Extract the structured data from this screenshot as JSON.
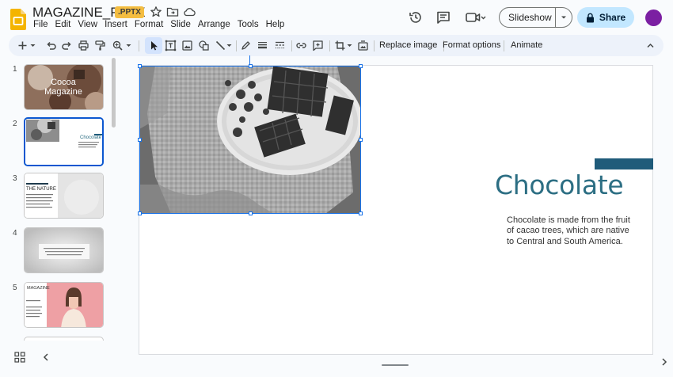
{
  "header": {
    "title": "MAGAZINE_PPTX",
    "badge": ".PPTX",
    "menu": [
      "File",
      "Edit",
      "View",
      "Insert",
      "Format",
      "Slide",
      "Arrange",
      "Tools",
      "Help"
    ]
  },
  "actions": {
    "slideshow_label": "Slideshow",
    "share_label": "Share"
  },
  "toolbar": {
    "replace_image": "Replace image",
    "format_options": "Format options",
    "animate": "Animate"
  },
  "filmstrip": {
    "slides": [
      {
        "number": "1",
        "title": "Cocoa Magazine"
      },
      {
        "number": "2",
        "title": "Chocolate"
      },
      {
        "number": "3",
        "title": "THE NATURE"
      },
      {
        "number": "4",
        "title": ""
      },
      {
        "number": "5",
        "title": "MAGAZINE"
      }
    ]
  },
  "slide": {
    "title": "Chocolate",
    "body": "Chocolate is made from the fruit of cacao trees, which are native to Central and South America."
  },
  "colors": {
    "accent": "#1f5b7a",
    "title": "#2c6e83",
    "share_bg": "#c2e7ff",
    "selection": "#1a73e8"
  }
}
